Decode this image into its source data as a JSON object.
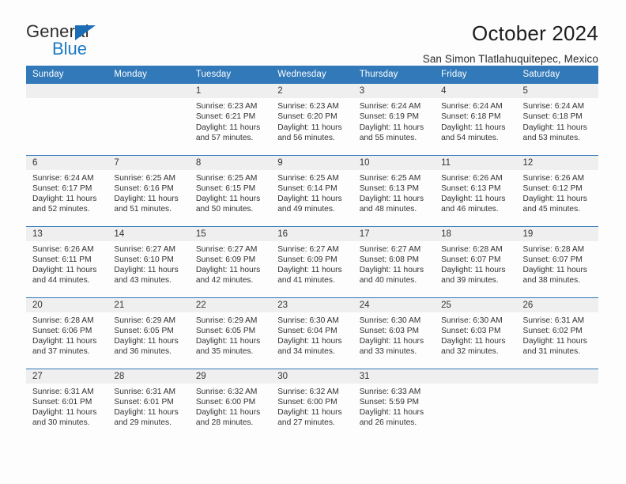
{
  "logo": {
    "word_top": "General",
    "word_bottom": "Blue",
    "triangle_color": "#1b6db5",
    "blue_text_color": "#1b7ac4"
  },
  "header": {
    "month_title": "October 2024",
    "location": "San Simon Tlatlahuquitepec, Mexico",
    "accent_color": "#3179b9"
  },
  "calendar": {
    "weekday_headers": [
      "Sunday",
      "Monday",
      "Tuesday",
      "Wednesday",
      "Thursday",
      "Friday",
      "Saturday"
    ],
    "weeks": [
      [
        {
          "day": "",
          "detail": ""
        },
        {
          "day": "",
          "detail": ""
        },
        {
          "day": "1",
          "detail": "Sunrise: 6:23 AM\nSunset: 6:21 PM\nDaylight: 11 hours\nand 57 minutes."
        },
        {
          "day": "2",
          "detail": "Sunrise: 6:23 AM\nSunset: 6:20 PM\nDaylight: 11 hours\nand 56 minutes."
        },
        {
          "day": "3",
          "detail": "Sunrise: 6:24 AM\nSunset: 6:19 PM\nDaylight: 11 hours\nand 55 minutes."
        },
        {
          "day": "4",
          "detail": "Sunrise: 6:24 AM\nSunset: 6:18 PM\nDaylight: 11 hours\nand 54 minutes."
        },
        {
          "day": "5",
          "detail": "Sunrise: 6:24 AM\nSunset: 6:18 PM\nDaylight: 11 hours\nand 53 minutes."
        }
      ],
      [
        {
          "day": "6",
          "detail": "Sunrise: 6:24 AM\nSunset: 6:17 PM\nDaylight: 11 hours\nand 52 minutes."
        },
        {
          "day": "7",
          "detail": "Sunrise: 6:25 AM\nSunset: 6:16 PM\nDaylight: 11 hours\nand 51 minutes."
        },
        {
          "day": "8",
          "detail": "Sunrise: 6:25 AM\nSunset: 6:15 PM\nDaylight: 11 hours\nand 50 minutes."
        },
        {
          "day": "9",
          "detail": "Sunrise: 6:25 AM\nSunset: 6:14 PM\nDaylight: 11 hours\nand 49 minutes."
        },
        {
          "day": "10",
          "detail": "Sunrise: 6:25 AM\nSunset: 6:13 PM\nDaylight: 11 hours\nand 48 minutes."
        },
        {
          "day": "11",
          "detail": "Sunrise: 6:26 AM\nSunset: 6:13 PM\nDaylight: 11 hours\nand 46 minutes."
        },
        {
          "day": "12",
          "detail": "Sunrise: 6:26 AM\nSunset: 6:12 PM\nDaylight: 11 hours\nand 45 minutes."
        }
      ],
      [
        {
          "day": "13",
          "detail": "Sunrise: 6:26 AM\nSunset: 6:11 PM\nDaylight: 11 hours\nand 44 minutes."
        },
        {
          "day": "14",
          "detail": "Sunrise: 6:27 AM\nSunset: 6:10 PM\nDaylight: 11 hours\nand 43 minutes."
        },
        {
          "day": "15",
          "detail": "Sunrise: 6:27 AM\nSunset: 6:09 PM\nDaylight: 11 hours\nand 42 minutes."
        },
        {
          "day": "16",
          "detail": "Sunrise: 6:27 AM\nSunset: 6:09 PM\nDaylight: 11 hours\nand 41 minutes."
        },
        {
          "day": "17",
          "detail": "Sunrise: 6:27 AM\nSunset: 6:08 PM\nDaylight: 11 hours\nand 40 minutes."
        },
        {
          "day": "18",
          "detail": "Sunrise: 6:28 AM\nSunset: 6:07 PM\nDaylight: 11 hours\nand 39 minutes."
        },
        {
          "day": "19",
          "detail": "Sunrise: 6:28 AM\nSunset: 6:07 PM\nDaylight: 11 hours\nand 38 minutes."
        }
      ],
      [
        {
          "day": "20",
          "detail": "Sunrise: 6:28 AM\nSunset: 6:06 PM\nDaylight: 11 hours\nand 37 minutes."
        },
        {
          "day": "21",
          "detail": "Sunrise: 6:29 AM\nSunset: 6:05 PM\nDaylight: 11 hours\nand 36 minutes."
        },
        {
          "day": "22",
          "detail": "Sunrise: 6:29 AM\nSunset: 6:05 PM\nDaylight: 11 hours\nand 35 minutes."
        },
        {
          "day": "23",
          "detail": "Sunrise: 6:30 AM\nSunset: 6:04 PM\nDaylight: 11 hours\nand 34 minutes."
        },
        {
          "day": "24",
          "detail": "Sunrise: 6:30 AM\nSunset: 6:03 PM\nDaylight: 11 hours\nand 33 minutes."
        },
        {
          "day": "25",
          "detail": "Sunrise: 6:30 AM\nSunset: 6:03 PM\nDaylight: 11 hours\nand 32 minutes."
        },
        {
          "day": "26",
          "detail": "Sunrise: 6:31 AM\nSunset: 6:02 PM\nDaylight: 11 hours\nand 31 minutes."
        }
      ],
      [
        {
          "day": "27",
          "detail": "Sunrise: 6:31 AM\nSunset: 6:01 PM\nDaylight: 11 hours\nand 30 minutes."
        },
        {
          "day": "28",
          "detail": "Sunrise: 6:31 AM\nSunset: 6:01 PM\nDaylight: 11 hours\nand 29 minutes."
        },
        {
          "day": "29",
          "detail": "Sunrise: 6:32 AM\nSunset: 6:00 PM\nDaylight: 11 hours\nand 28 minutes."
        },
        {
          "day": "30",
          "detail": "Sunrise: 6:32 AM\nSunset: 6:00 PM\nDaylight: 11 hours\nand 27 minutes."
        },
        {
          "day": "31",
          "detail": "Sunrise: 6:33 AM\nSunset: 5:59 PM\nDaylight: 11 hours\nand 26 minutes."
        },
        {
          "day": "",
          "detail": ""
        },
        {
          "day": "",
          "detail": ""
        }
      ]
    ]
  }
}
